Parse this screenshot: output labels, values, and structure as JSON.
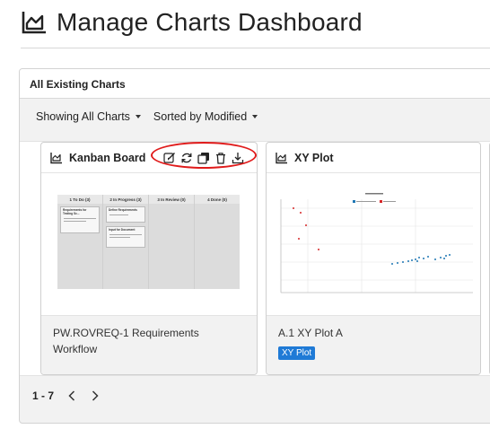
{
  "page": {
    "title": "Manage Charts Dashboard",
    "icon": "area-chart-icon"
  },
  "panel": {
    "title": "All Existing Charts"
  },
  "toolbar": {
    "filter_label": "Showing All Charts",
    "sort_label": "Sorted by Modified"
  },
  "cards": [
    {
      "title": "Kanban Board",
      "name_line1": "PW.ROVREQ-1 Requirements",
      "name_line2": "Workflow",
      "actions": [
        "edit-icon",
        "refresh-icon",
        "copy-icon",
        "trash-icon",
        "download-icon"
      ],
      "preview": {
        "columns": [
          "1 To Do (3)",
          "2 In Progress (3)",
          "3 In Review (0)",
          "4 Done (0)"
        ],
        "cards": [
          "Requirements for Testing Sc...",
          "Define Requirements",
          "Input for Document"
        ]
      }
    },
    {
      "title": "XY Plot",
      "name_line1": "A.1 XY Plot A",
      "badge": "XY Plot"
    }
  ],
  "pagination": {
    "range": "1 - 7",
    "prev": "‹",
    "next": "›"
  },
  "colors": {
    "accent": "#1f7ad6",
    "annotation": "#e01b1b",
    "panel_bg": "#f2f2f2"
  }
}
